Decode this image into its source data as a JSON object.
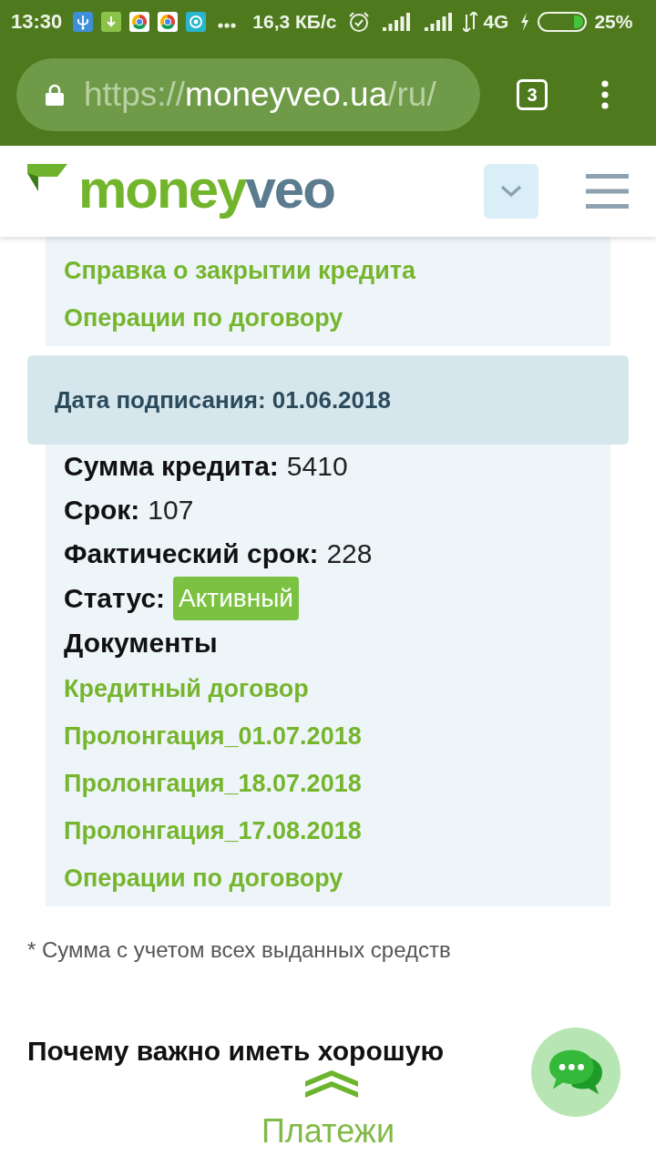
{
  "status_bar": {
    "time": "13:30",
    "speed": "16,3 КБ/с",
    "network": "4G",
    "battery": "25%"
  },
  "browser": {
    "url_scheme": "https://",
    "url_host": "moneyveo.ua",
    "url_path": "/ru/",
    "tab_count": "3"
  },
  "site_header": {
    "logo": {
      "primary": "money",
      "secondary": "veo"
    }
  },
  "previous_contract": {
    "links": [
      "Справка о закрытии кредита",
      "Операции по договору"
    ]
  },
  "contract": {
    "signing_date": "Дата подписания: 01.06.2018",
    "fields": [
      {
        "label": "Сумма кредита:",
        "value": "5410",
        "kind": "text"
      },
      {
        "label": "Срок:",
        "value": "107",
        "kind": "text"
      },
      {
        "label": "Фактический срок:",
        "value": "228",
        "kind": "text"
      },
      {
        "label": "Статус:",
        "value": "Активный",
        "kind": "badge"
      }
    ],
    "documents_title": "Документы",
    "documents": [
      "Кредитный договор",
      "Пролонгация_01.07.2018",
      "Пролонгация_18.07.2018",
      "Пролонгация_17.08.2018",
      "Операции по договору"
    ]
  },
  "footnote": "* Сумма с учетом всех выданных средств",
  "section_heading": "Почему важно иметь хорошую",
  "bottom_nav": {
    "label": "Платежи"
  }
}
